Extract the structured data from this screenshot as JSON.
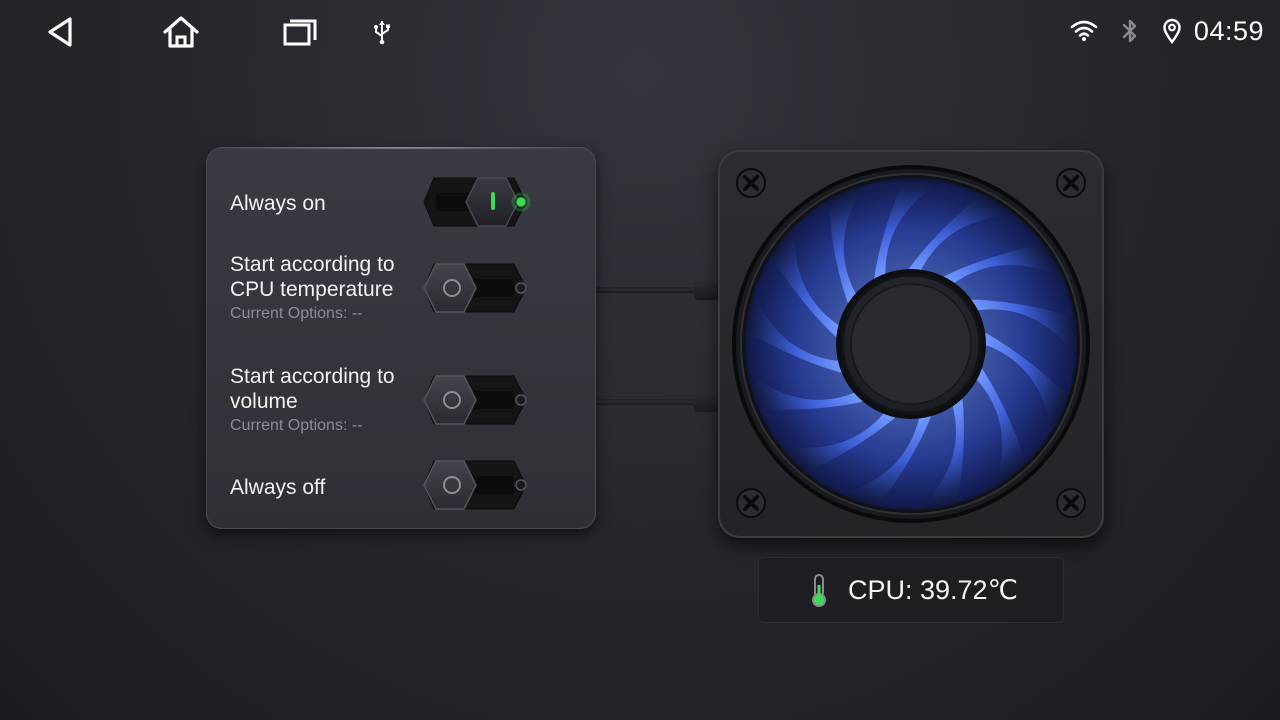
{
  "status_bar": {
    "time": "04:59",
    "icons": [
      "wifi-icon",
      "bluetooth-icon",
      "location-icon"
    ]
  },
  "navigation": {
    "buttons": [
      "back-icon",
      "home-icon",
      "recent-apps-icon",
      "usb-icon"
    ]
  },
  "fan_modes": {
    "options": [
      {
        "label": "Always on",
        "sublabel": "",
        "state": "on"
      },
      {
        "label": "Start according to CPU temperature",
        "sublabel": "Current Options: --",
        "state": "off"
      },
      {
        "label": "Start according to volume",
        "sublabel": "Current Options: --",
        "state": "off"
      },
      {
        "label": "Always off",
        "sublabel": "",
        "state": "off"
      }
    ]
  },
  "cpu": {
    "readout": "CPU: 39.72℃"
  },
  "colors": {
    "active_indicator": "#3ddc57",
    "fan_glow": "#4d7dff"
  }
}
